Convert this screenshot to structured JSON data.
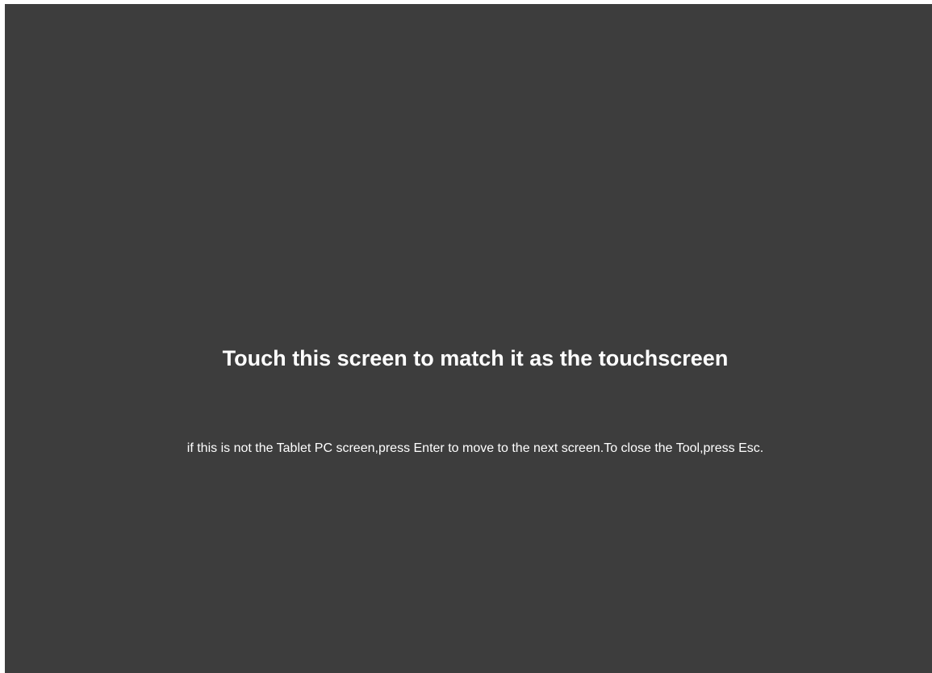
{
  "screen": {
    "title": "Touch this screen to match it as the touchscreen",
    "instructions": "if this is not the Tablet PC screen,press Enter to move to the next screen.To close the Tool,press Esc."
  },
  "colors": {
    "background": "#3d3d3d",
    "frame": "#ffffff",
    "text": "#ffffff"
  }
}
